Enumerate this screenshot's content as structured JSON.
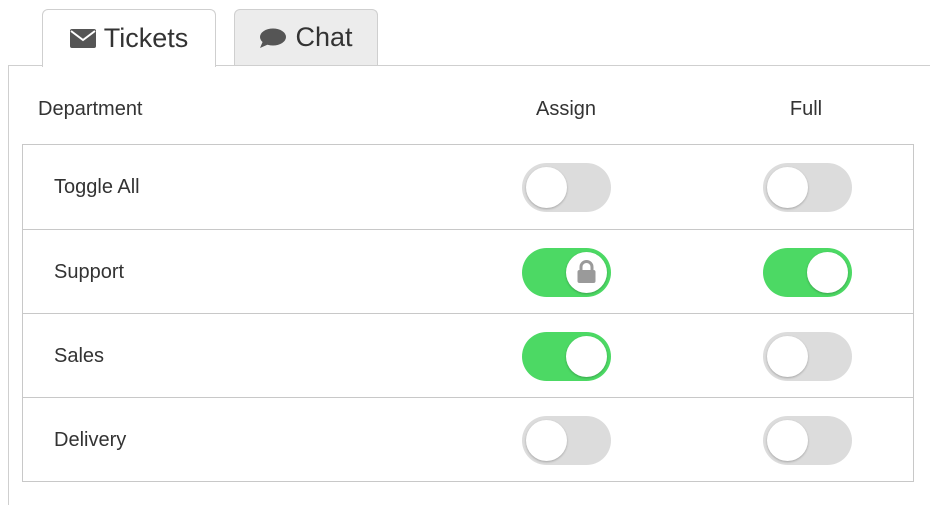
{
  "tabs": [
    {
      "label": "Tickets",
      "icon": "envelope-icon",
      "active": true
    },
    {
      "label": "Chat",
      "icon": "chat-bubble-icon",
      "active": false
    }
  ],
  "columns": {
    "department": "Department",
    "assign": "Assign",
    "full": "Full"
  },
  "rows": [
    {
      "label": "Toggle All",
      "assign": false,
      "full": false,
      "assign_locked": false
    },
    {
      "label": "Support",
      "assign": true,
      "full": true,
      "assign_locked": true
    },
    {
      "label": "Sales",
      "assign": true,
      "full": false,
      "assign_locked": false
    },
    {
      "label": "Delivery",
      "assign": false,
      "full": false,
      "assign_locked": false
    }
  ],
  "colors": {
    "toggle_on": "#4cd964",
    "toggle_off": "#dcdcdc",
    "border": "#c8c8c8",
    "text": "#333333"
  }
}
